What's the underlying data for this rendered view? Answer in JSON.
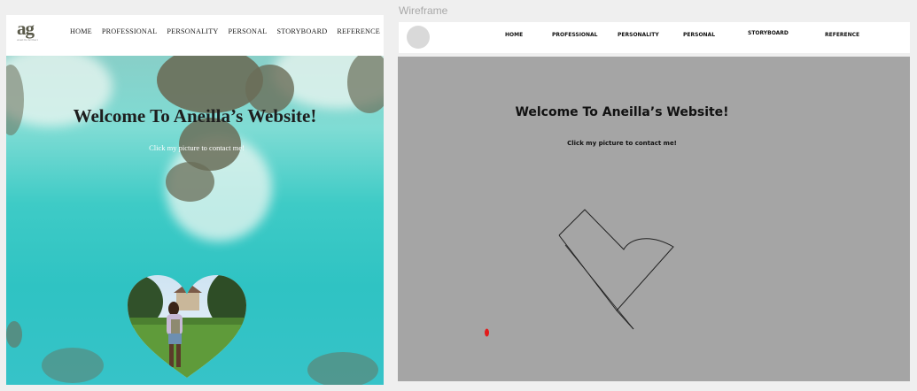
{
  "design": {
    "logo": {
      "mark": "ag",
      "sub": "Aneilla Gilbert"
    },
    "menu": [
      "HOME",
      "PROFESSIONAL",
      "PERSONALITY",
      "PERSONAL",
      "STORYBOARD",
      "REFERENCE"
    ],
    "hero": {
      "title": "Welcome To Aneilla’s Website!",
      "subtitle": "Click my picture to contact me!"
    }
  },
  "wireframe": {
    "label": "Wireframe",
    "menu": [
      "HOME",
      "PROFESSIONAL",
      "PERSONALITY",
      "PERSONAL",
      "STORYBOARD",
      "REFERENCE"
    ],
    "title": "Welcome To Aneilla’s Website!",
    "subtitle": "Click my picture to contact me!"
  },
  "colors": {
    "ocean": "#2fc3c3",
    "wireframe_bg": "#a5a5a5",
    "accent_red": "#e21b1b"
  }
}
